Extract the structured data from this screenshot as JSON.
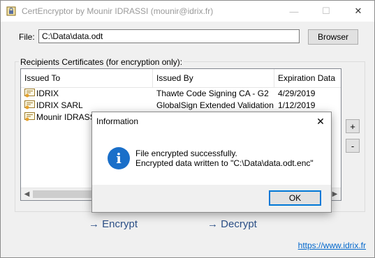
{
  "window": {
    "title": "CertEncryptor by Mounir IDRASSI (mounir@idrix.fr)",
    "minimize_glyph": "—",
    "maximize_glyph": "☐",
    "close_glyph": "✕"
  },
  "file": {
    "label": "File:",
    "value": "C:\\Data\\data.odt",
    "browse_label": "Browser"
  },
  "recipients": {
    "group_label": "Recipients Certificates (for encryption only):",
    "columns": [
      "Issued To",
      "Issued By",
      "Expiration Data"
    ],
    "rows": [
      {
        "issued_to": "IDRIX",
        "issued_by": "Thawte Code Signing CA - G2",
        "expiration": "4/29/2019"
      },
      {
        "issued_to": "IDRIX SARL",
        "issued_by": "GlobalSign Extended Validation...",
        "expiration": "1/12/2019"
      },
      {
        "issued_to": "Mounir IDRASSI",
        "issued_by": "",
        "expiration": ""
      }
    ],
    "add_label": "+",
    "remove_label": "-"
  },
  "actions": {
    "encrypt_label": "Encrypt",
    "decrypt_label": "Decrypt",
    "arrow": "→"
  },
  "footer": {
    "link_text": "https://www.idrix.fr"
  },
  "dialog": {
    "title": "Information",
    "close_glyph": "✕",
    "icon_glyph": "i",
    "message_line1": "File encrypted successfully.",
    "message_line2": "Encrypted data written to \"C:\\Data\\data.odt.enc\"",
    "ok_label": "OK"
  },
  "colors": {
    "accent": "#0078d7",
    "info_icon": "#1a6fc9",
    "action_text": "#2b4f86",
    "link": "#0066cc"
  }
}
